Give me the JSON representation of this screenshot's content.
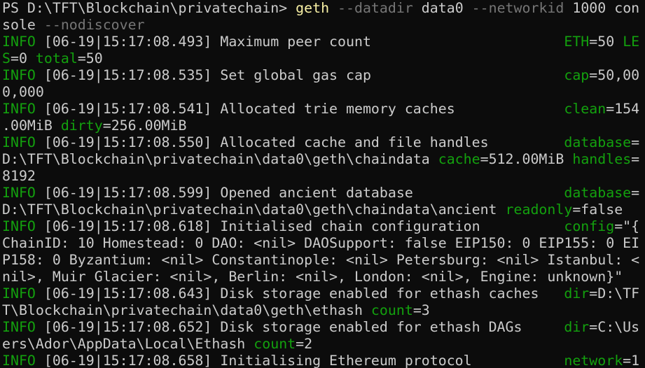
{
  "colors": {
    "background": "#0c0c0c",
    "default": "#cccccc",
    "green": "#13a10e",
    "yellow": "#f9f1a5",
    "gray": "#767676"
  },
  "terminal": {
    "rows": [
      [
        [
          "default",
          "PS D:\\TFT\\Blockchain\\privatechain> "
        ],
        [
          "yellow",
          "geth"
        ],
        [
          "gray",
          " --datadir"
        ],
        [
          "default",
          " data0"
        ],
        [
          "gray",
          " --networkid"
        ],
        [
          "default",
          " 1000 con"
        ]
      ],
      [
        [
          "default",
          "sole"
        ],
        [
          "gray",
          " --nodiscover"
        ]
      ],
      [
        [
          "green",
          "INFO"
        ],
        [
          "default",
          " [06-19|15:17:08.493] Maximum peer count                       "
        ],
        [
          "green",
          "ETH"
        ],
        [
          "default",
          "=50 "
        ],
        [
          "green",
          "LE"
        ]
      ],
      [
        [
          "green",
          "S"
        ],
        [
          "default",
          "=0 "
        ],
        [
          "green",
          "total"
        ],
        [
          "default",
          "=50"
        ]
      ],
      [
        [
          "green",
          "INFO"
        ],
        [
          "default",
          " [06-19|15:17:08.535] Set global gas cap                       "
        ],
        [
          "green",
          "cap"
        ],
        [
          "default",
          "=50,00"
        ]
      ],
      [
        [
          "default",
          "0,000"
        ]
      ],
      [
        [
          "green",
          "INFO"
        ],
        [
          "default",
          " [06-19|15:17:08.541] Allocated trie memory caches             "
        ],
        [
          "green",
          "clean"
        ],
        [
          "default",
          "=154"
        ]
      ],
      [
        [
          "default",
          ".00MiB "
        ],
        [
          "green",
          "dirty"
        ],
        [
          "default",
          "=256.00MiB"
        ]
      ],
      [
        [
          "green",
          "INFO"
        ],
        [
          "default",
          " [06-19|15:17:08.550] Allocated cache and file handles         "
        ],
        [
          "green",
          "database"
        ],
        [
          "default",
          "="
        ]
      ],
      [
        [
          "default",
          "D:\\TFT\\Blockchain\\privatechain\\data0\\geth\\chaindata "
        ],
        [
          "green",
          "cache"
        ],
        [
          "default",
          "=512.00MiB "
        ],
        [
          "green",
          "handles"
        ],
        [
          "default",
          "="
        ]
      ],
      [
        [
          "default",
          "8192"
        ]
      ],
      [
        [
          "green",
          "INFO"
        ],
        [
          "default",
          " [06-19|15:17:08.599] Opened ancient database                  "
        ],
        [
          "green",
          "database"
        ],
        [
          "default",
          "="
        ]
      ],
      [
        [
          "default",
          "D:\\TFT\\Blockchain\\privatechain\\data0\\geth\\chaindata\\ancient "
        ],
        [
          "green",
          "readonly"
        ],
        [
          "default",
          "=false"
        ]
      ],
      [
        [
          "green",
          "INFO"
        ],
        [
          "default",
          " [06-19|15:17:08.618] Initialised chain configuration          "
        ],
        [
          "green",
          "config"
        ],
        [
          "default",
          "=\"{"
        ]
      ],
      [
        [
          "default",
          "ChainID: 10 Homestead: 0 DAO: <nil> DAOSupport: false EIP150: 0 EIP155: 0 EI"
        ]
      ],
      [
        [
          "default",
          "P158: 0 Byzantium: <nil> Constantinople: <nil> Petersburg: <nil> Istanbul: <"
        ]
      ],
      [
        [
          "default",
          "nil>, Muir Glacier: <nil>, Berlin: <nil>, London: <nil>, Engine: unknown}\""
        ]
      ],
      [
        [
          "green",
          "INFO"
        ],
        [
          "default",
          " [06-19|15:17:08.643] Disk storage enabled for ethash caches   "
        ],
        [
          "green",
          "dir"
        ],
        [
          "default",
          "=D:\\TF"
        ]
      ],
      [
        [
          "default",
          "T\\Blockchain\\privatechain\\data0\\geth\\ethash "
        ],
        [
          "green",
          "count"
        ],
        [
          "default",
          "=3"
        ]
      ],
      [
        [
          "green",
          "INFO"
        ],
        [
          "default",
          " [06-19|15:17:08.652] Disk storage enabled for ethash DAGs     "
        ],
        [
          "green",
          "dir"
        ],
        [
          "default",
          "=C:\\Us"
        ]
      ],
      [
        [
          "default",
          "ers\\Ador\\AppData\\Local\\Ethash "
        ],
        [
          "green",
          "count"
        ],
        [
          "default",
          "=2"
        ]
      ],
      [
        [
          "green",
          "INFO"
        ],
        [
          "default",
          " [06-19|15:17:08.658] Initialising Ethereum protocol           "
        ],
        [
          "green",
          "network"
        ],
        [
          "default",
          "=1"
        ]
      ]
    ]
  }
}
